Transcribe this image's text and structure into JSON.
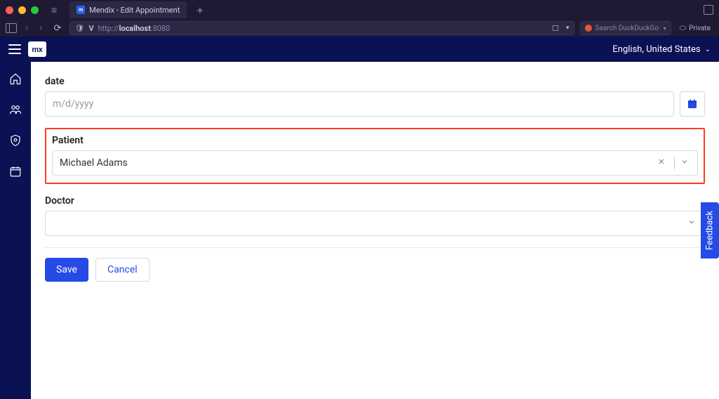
{
  "browser": {
    "tab_title": "Mendix - Edit Appointment",
    "url_prefix": "http://",
    "url_host": "localhost",
    "url_port": ":8080",
    "search_placeholder": "Search DuckDuckGo",
    "private_label": "Private"
  },
  "header": {
    "logo_text": "mx",
    "language": "English, United States"
  },
  "form": {
    "date": {
      "label": "date",
      "placeholder": "m/d/yyyy",
      "value": ""
    },
    "patient": {
      "label": "Patient",
      "value": "Michael Adams"
    },
    "doctor": {
      "label": "Doctor",
      "value": ""
    },
    "save_label": "Save",
    "cancel_label": "Cancel"
  },
  "feedback_label": "Feedback"
}
